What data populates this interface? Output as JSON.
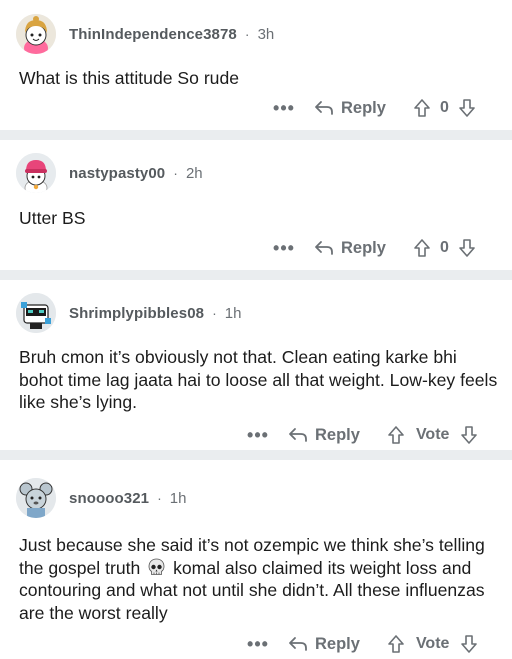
{
  "comments": [
    {
      "author": "ThinIndependence3878",
      "time": "3h",
      "body": "What is this attitude So rude",
      "more": "•••",
      "reply": "Reply",
      "score": "0"
    },
    {
      "author": "nastypasty00",
      "time": "2h",
      "body": "Utter BS",
      "more": "•••",
      "reply": "Reply",
      "score": "0"
    },
    {
      "author": "Shrimplypibbles08",
      "time": "1h",
      "body": "Bruh cmon it’s obviously not that. Clean eating karke bhi bohot time lag jaata hai to loose all that weight. Low-key feels like she’s lying.",
      "more": "•••",
      "reply": "Reply",
      "score": "Vote"
    },
    {
      "author": "snoooo321",
      "time": "1h",
      "body_before": "Just because she said it’s not ozempic we think she’s telling the gospel truth",
      "body_after": "komal also claimed its weight loss and contouring and what not until she didn’t. All these influenzas are the worst really",
      "more": "•••",
      "reply": "Reply",
      "score": "Vote"
    }
  ],
  "separator": "·",
  "colors": {
    "meta": "#6b7075",
    "separator_band": "#eaedef",
    "text": "#1c1c1c"
  }
}
